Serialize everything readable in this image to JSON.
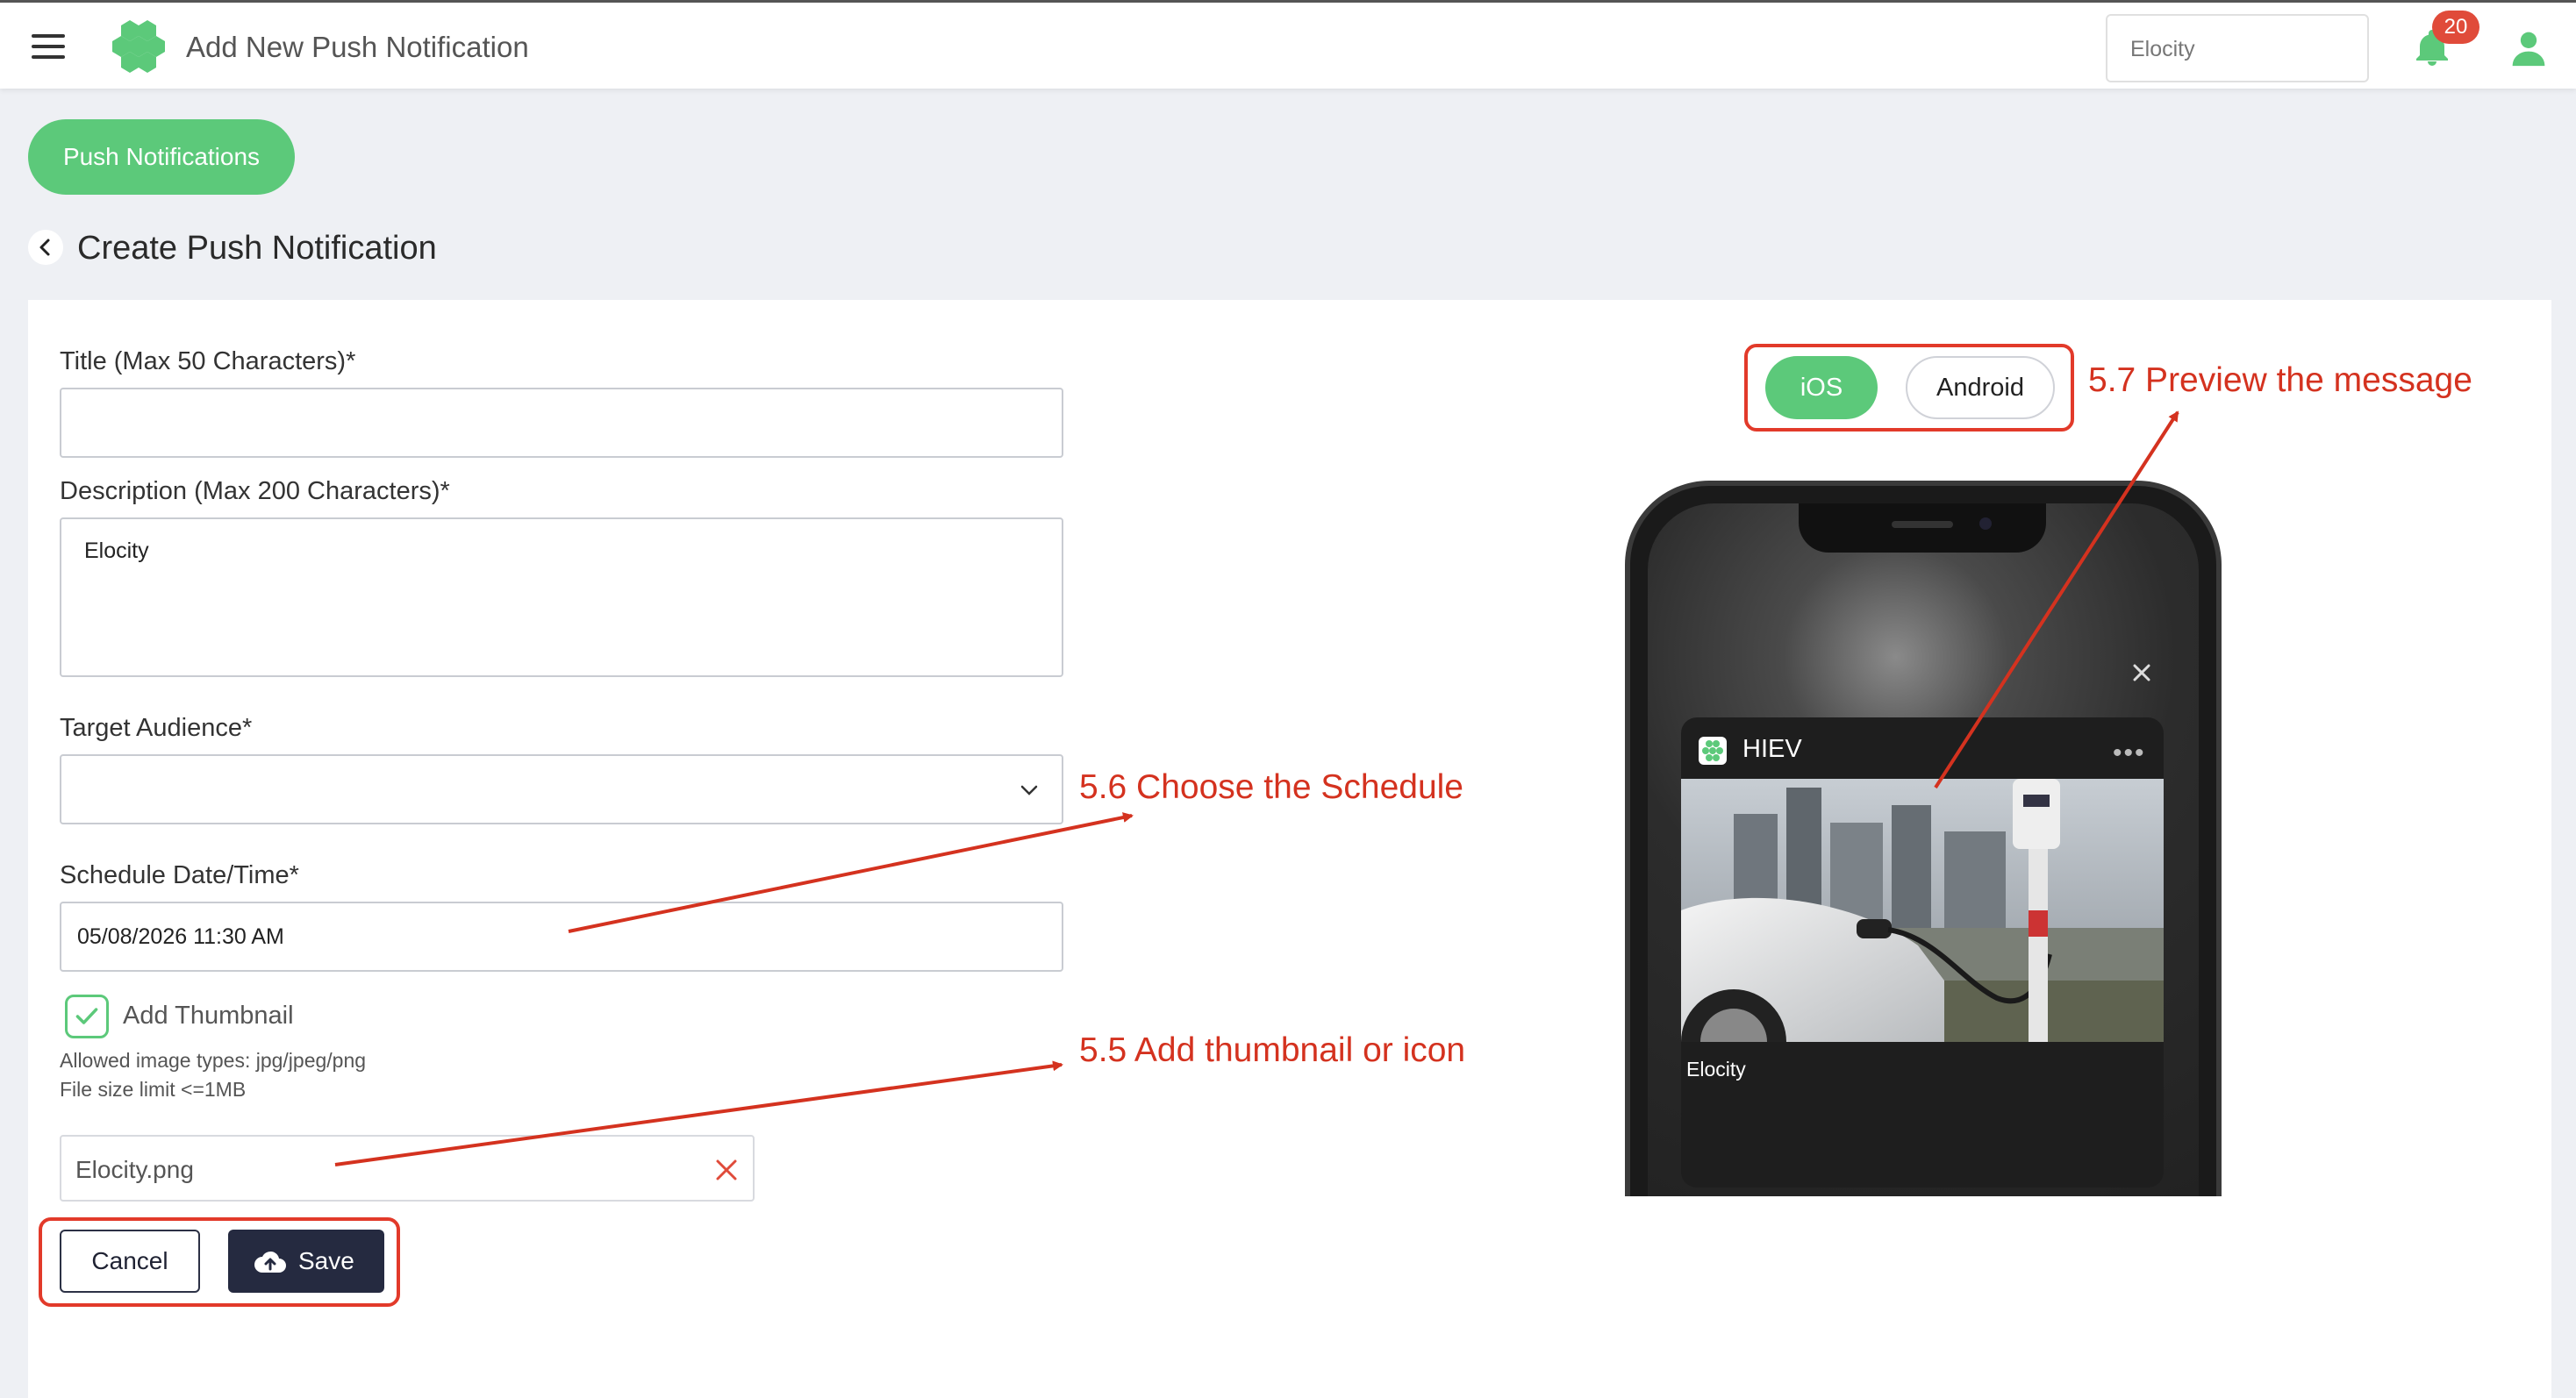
{
  "header": {
    "title": "Add New Push Notification",
    "org_select": "Elocity",
    "notification_count": "20"
  },
  "nav": {
    "pill_tab": "Push Notifications"
  },
  "page": {
    "title": "Create Push Notification"
  },
  "form": {
    "title_label": "Title (Max 50 Characters)*",
    "title_value": "",
    "description_label": "Description (Max 200 Characters)*",
    "description_value": "Elocity",
    "audience_label": "Target Audience*",
    "audience_value": "",
    "schedule_label": "Schedule Date/Time*",
    "schedule_value": "05/08/2026 11:30 AM",
    "thumbnail_label": "Add Thumbnail",
    "thumbnail_checked": true,
    "hint_types": "Allowed image types: jpg/jpeg/png",
    "hint_size": "File size limit <=1MB",
    "file_name": "Elocity.png",
    "cancel_label": "Cancel",
    "save_label": "Save"
  },
  "preview": {
    "os_ios": "iOS",
    "os_android": "Android",
    "selected_os": "iOS",
    "app_name": "HIEV",
    "description": "Elocity"
  },
  "annotations": {
    "step_5_5": "5.5 Add thumbnail or icon",
    "step_5_6": "5.6 Choose the Schedule",
    "step_5_7": "5.7 Preview the message"
  },
  "colors": {
    "accent_green": "#5cc97a",
    "annotation_red": "#d4321f",
    "save_button": "#252a40",
    "badge_red": "#e04b3a"
  }
}
